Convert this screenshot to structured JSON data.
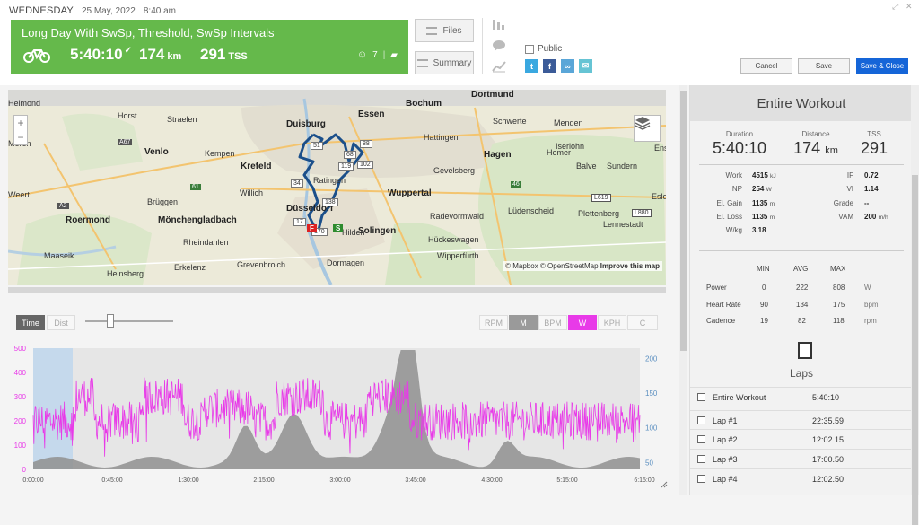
{
  "header": {
    "weekday": "WEDNESDAY",
    "date": "25 May, 2022",
    "time": "8:40 am",
    "title": "Long Day With SwSp, Threshold, SwSp Intervals",
    "duration": "5:40:10",
    "distance": "174",
    "distance_unit": "km",
    "tss": "291",
    "tss_unit": "TSS",
    "likes": "7",
    "files_label": "Files",
    "summary_label": "Summary",
    "public_label": "Public",
    "cancel_label": "Cancel",
    "save_label": "Save",
    "save_close_label": "Save & Close",
    "hero_color": "#65b94b"
  },
  "map": {
    "cities": [
      "Duisburg",
      "Essen",
      "Bochum",
      "Krefeld",
      "Hagen",
      "Wuppertal",
      "Mönchengladbach",
      "Roermond",
      "Solingen",
      "Venlo",
      "Dortmund"
    ],
    "labels": [
      "Helmond",
      "Horst",
      "Straelen",
      "Kempen",
      "Willich",
      "Brüggen",
      "Weert",
      "Rheindahlen",
      "Erkelenz",
      "Grevenbroich",
      "Dormagen",
      "Heinsberg",
      "Maaseik",
      "Schwerte",
      "Menden",
      "Iserlohn",
      "Balve",
      "Sundern",
      "Hattingen",
      "Gevelsberg",
      "Radevormwald",
      "Lüdenscheid",
      "Plettenberg",
      "Hückeswagen",
      "Wipperfürth",
      "Lennestadt",
      "Ratingen",
      "Düsseldorf",
      "Hilden",
      "Hemer",
      "Ens",
      "Eslo",
      "Uden",
      "Asten",
      "Meren"
    ],
    "route_markers": [
      "51",
      "88",
      "68",
      "102",
      "119",
      "34",
      "138",
      "17",
      "170",
      "S",
      "F"
    ],
    "attribution_mapbox": "© Mapbox",
    "attribution_osm": "© OpenStreetMap",
    "attribution_improve": "Improve this map",
    "road_labels": [
      "A67",
      "A2",
      "A57",
      "61",
      "L619",
      "L880",
      "46",
      "3",
      "4"
    ]
  },
  "chart_controls": {
    "time_label": "Time",
    "dist_label": "Dist",
    "channels": [
      "RPM",
      "M",
      "BPM",
      "W",
      "KPH",
      "C"
    ]
  },
  "chart_data": {
    "type": "area",
    "x_ticks": [
      "0:00:00",
      "0:45:00",
      "1:30:00",
      "2:15:00",
      "3:00:00",
      "3:45:00",
      "4:30:00",
      "5:15:00",
      "6:15:00"
    ],
    "y_left_ticks": [
      "0",
      "100",
      "200",
      "300",
      "400",
      "500"
    ],
    "y_right_ticks": [
      "50",
      "100",
      "150",
      "200"
    ],
    "ylim_left": [
      0,
      500
    ],
    "ylim_right": [
      40,
      215
    ],
    "series": [
      {
        "name": "W",
        "color": "#e83ae8"
      },
      {
        "name": "M",
        "color": "#7a7a7a"
      }
    ]
  },
  "summary": {
    "title": "Entire Workout",
    "duration_label": "Duration",
    "duration": "5:40:10",
    "distance_label": "Distance",
    "distance": "174",
    "distance_unit": "km",
    "tss_label": "TSS",
    "tss": "291",
    "metrics_left": [
      {
        "k": "Work",
        "v": "4515",
        "u": "kJ"
      },
      {
        "k": "NP",
        "v": "254",
        "u": "W"
      },
      {
        "k": "El. Gain",
        "v": "1135",
        "u": "m"
      },
      {
        "k": "El. Loss",
        "v": "1135",
        "u": "m"
      },
      {
        "k": "W/kg",
        "v": "3.18",
        "u": ""
      }
    ],
    "metrics_right": [
      {
        "k": "IF",
        "v": "0.72",
        "u": ""
      },
      {
        "k": "VI",
        "v": "1.14",
        "u": ""
      },
      {
        "k": "Grade",
        "v": "--",
        "u": ""
      },
      {
        "k": "VAM",
        "v": "200",
        "u": "m/h"
      }
    ],
    "table_headers": [
      "MIN",
      "AVG",
      "MAX"
    ],
    "table_rows": [
      {
        "k": "Power",
        "min": "0",
        "avg": "222",
        "max": "808",
        "u": "W"
      },
      {
        "k": "Heart Rate",
        "min": "90",
        "avg": "134",
        "max": "175",
        "u": "bpm"
      },
      {
        "k": "Cadence",
        "min": "19",
        "avg": "82",
        "max": "118",
        "u": "rpm"
      }
    ],
    "laps_title": "Laps",
    "laps": [
      {
        "name": "Entire Workout",
        "time": "5:40:10"
      },
      {
        "name": "Lap #1",
        "time": "22:35.59"
      },
      {
        "name": "Lap #2",
        "time": "12:02.15"
      },
      {
        "name": "Lap #3",
        "time": "17:00.50"
      },
      {
        "name": "Lap #4",
        "time": "12:02.50"
      }
    ]
  }
}
